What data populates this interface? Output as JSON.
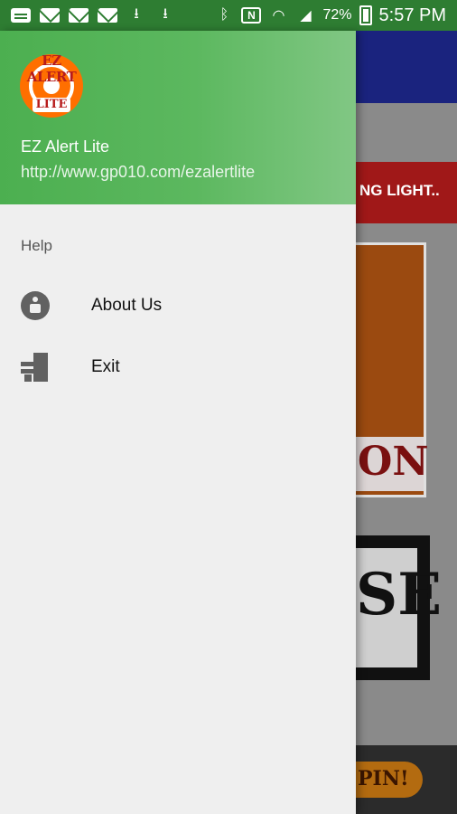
{
  "status_bar": {
    "battery_percent": "72%",
    "time": "5:57 PM"
  },
  "background_app": {
    "banner_text": "NG LIGHT..",
    "sign_text_1": "ON",
    "sign_text_2": "SE",
    "button_text": "PIN!"
  },
  "drawer": {
    "logo": {
      "top_text": "EZ ALERT",
      "bottom_text": "LITE"
    },
    "app_name": "EZ Alert Lite",
    "app_url": "http://www.gp010.com/ezalertlite",
    "section_label": "Help",
    "items": [
      {
        "label": "About Us",
        "icon": "info-icon"
      },
      {
        "label": "Exit",
        "icon": "exit-icon"
      }
    ],
    "colors": {
      "header_green": "#4caf50",
      "drawer_bg": "#efefef",
      "icon_gray": "#616161"
    }
  }
}
